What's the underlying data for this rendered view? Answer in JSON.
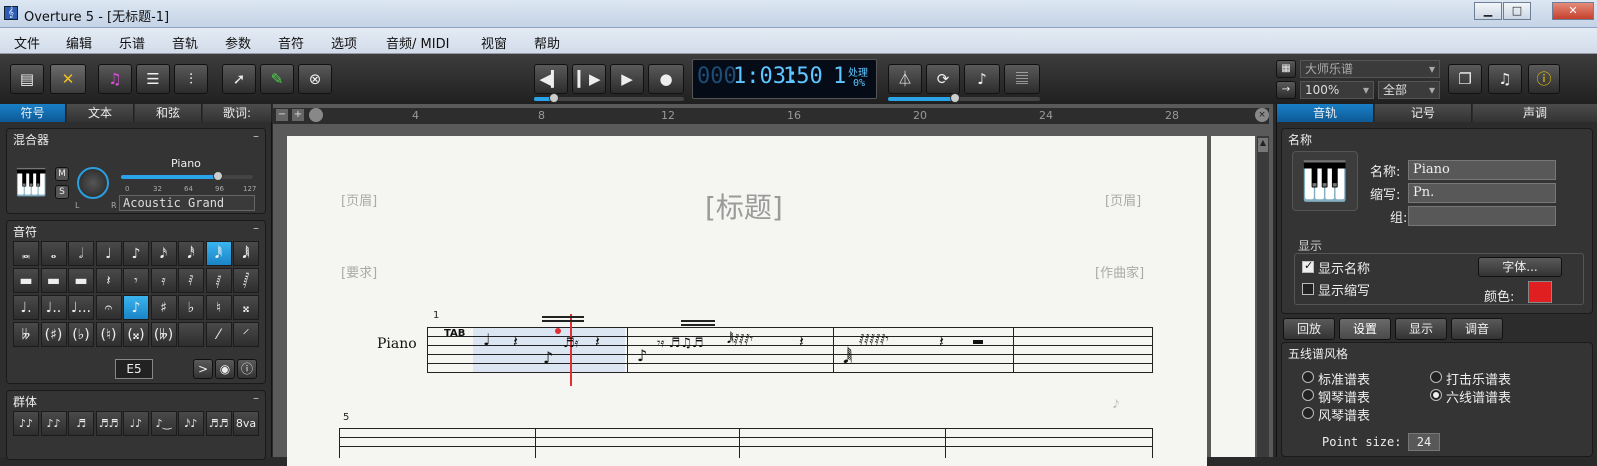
{
  "window": {
    "title": "Overture 5 - [无标题-1]",
    "app_icon": "treble-clef-icon",
    "controls": [
      "minimize-icon",
      "maximize-icon",
      "close-icon"
    ]
  },
  "menu": [
    "文件",
    "编辑",
    "乐谱",
    "音轨",
    "参数",
    "音符",
    "选项",
    "音频/ MIDI",
    "视窗",
    "帮助"
  ],
  "toolbar": {
    "left_icons": [
      "score-view-icon",
      "tools-icon",
      "notes-icon",
      "list-icon",
      "mixer-icon",
      "arrow-tool-icon",
      "pencil-tool-icon",
      "eraser-tool-icon"
    ],
    "transport_icons": [
      "rewind-icon",
      "play-from-start-icon",
      "play-icon",
      "record-icon"
    ],
    "lcd": {
      "position_dim": "000",
      "position": "1:03:",
      "tempo": "150",
      "value": "1",
      "status_label": "处理",
      "percent": "0%"
    },
    "right_icons": [
      "metronome-icon",
      "loop-icon",
      "note-entry-icon",
      "staff-icon"
    ],
    "style_combo": "大师乐谱",
    "zoom_combo": "100%",
    "view_combo": "全部",
    "info_icon": "info-icon"
  },
  "left_panel": {
    "tabs": [
      "符号",
      "文本",
      "和弦",
      "歌词:"
    ],
    "mixer": {
      "title": "混合器",
      "instrument": "Piano",
      "mute": "M",
      "solo": "S",
      "pan_l": "L",
      "pan_r": "R",
      "scale": [
        "0",
        "32",
        "64",
        "96",
        "127"
      ],
      "volume": 0.75,
      "patch": "Acoustic Grand"
    },
    "notes": {
      "title": "音符",
      "note_name": "E5",
      "rows": [
        [
          "𝅜",
          "𝅝",
          "𝅗𝅥",
          "♩",
          "♪",
          "𝅘𝅥𝅯",
          "𝅘𝅥𝅰",
          "𝅘𝅥𝅱",
          "𝅘𝅥𝅲"
        ],
        [
          "▬",
          "▬",
          "▬",
          "𝄽",
          "𝄾",
          "𝄿",
          "𝅀",
          "𝅁",
          "𝅂"
        ],
        [
          "♩.",
          "♩..",
          "♩...",
          "𝄐",
          "♪",
          "♯",
          "♭",
          "♮",
          "𝄪"
        ],
        [
          "𝄫",
          "(♯)",
          "(♭)",
          "(♮)",
          "(𝄪)",
          "(𝄫)",
          "",
          "⁄",
          "⸍"
        ]
      ]
    },
    "groups": {
      "title": "群体",
      "items": [
        "♪♪",
        "♪♪",
        "♬",
        "♬♬",
        "♩♪",
        "♪‿",
        "𝅘𝅥𝅯♪",
        "♬♬",
        "8va"
      ]
    }
  },
  "score": {
    "ruler_ticks": [
      "4",
      "8",
      "12",
      "16",
      "20",
      "24",
      "28"
    ],
    "header_left": "[页眉]",
    "header_right": "[页眉]",
    "title": "[标题]",
    "request": "[要求]",
    "composer": "[作曲家]",
    "measure_1": "1",
    "measure_5": "5",
    "staff_name": "Piano",
    "tab_label": "TAB"
  },
  "right_panel": {
    "tabs": [
      "音轨",
      "记号",
      "声调"
    ],
    "name_section": "名称",
    "name_label": "名称:",
    "name_value": "Piano",
    "abbr_label": "缩写:",
    "abbr_value": "Pn.",
    "group_label": "组:",
    "group_value": "",
    "display_title": "显示",
    "show_name": "显示名称",
    "show_abbr": "显示缩写",
    "font_button": "字体...",
    "color_label": "颜色:",
    "color": "#e02020",
    "subtabs": [
      "回放",
      "设置",
      "显示",
      "调音"
    ],
    "staff_style_title": "五线谱风格",
    "styles": [
      "标准谱表",
      "打击乐谱表",
      "钢琴谱表",
      "六线谱谱表",
      "风琴谱表"
    ],
    "selected_style": "六线谱谱表",
    "point_size_label": "Point size:",
    "point_size": "24"
  }
}
